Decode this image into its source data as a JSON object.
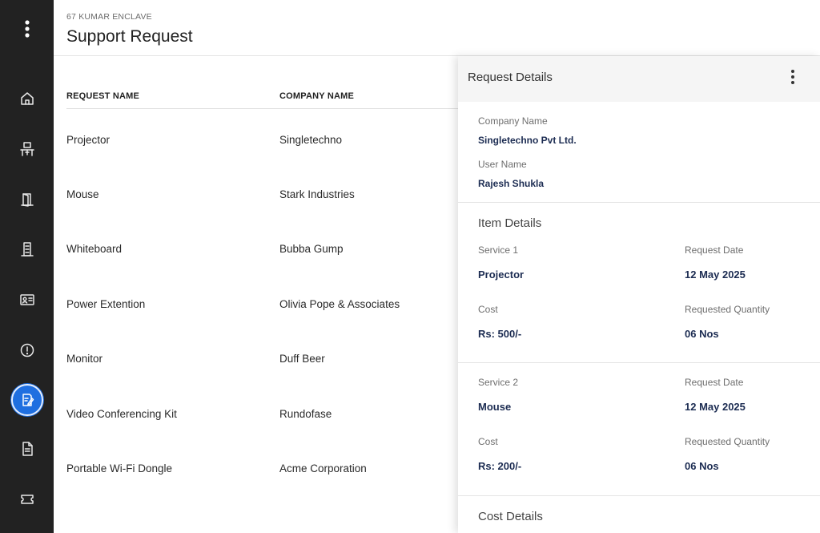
{
  "sidebar": {
    "items": [
      {
        "name": "home",
        "icon": "home-icon"
      },
      {
        "name": "workstation",
        "icon": "desk-icon"
      },
      {
        "name": "rooms",
        "icon": "door-icon"
      },
      {
        "name": "building",
        "icon": "building-icon"
      },
      {
        "name": "id-card",
        "icon": "id-card-icon"
      },
      {
        "name": "alerts",
        "icon": "alert-icon"
      },
      {
        "name": "support-request",
        "icon": "edit-note-icon",
        "active": true
      },
      {
        "name": "documents",
        "icon": "document-icon"
      },
      {
        "name": "tickets",
        "icon": "ticket-icon"
      }
    ]
  },
  "header": {
    "breadcrumb": "67 KUMAR ENCLAVE",
    "title": "Support Request"
  },
  "table": {
    "columns": [
      "REQUEST NAME",
      "COMPANY NAME"
    ],
    "rows": [
      {
        "request": "Projector",
        "company": "Singletechno"
      },
      {
        "request": "Mouse",
        "company": "Stark Industries"
      },
      {
        "request": "Whiteboard",
        "company": "Bubba Gump"
      },
      {
        "request": "Power Extention",
        "company": "Olivia Pope & Associates"
      },
      {
        "request": "Monitor",
        "company": "Duff Beer"
      },
      {
        "request": "Video Conferencing Kit",
        "company": "Rundofase"
      },
      {
        "request": "Portable Wi-Fi Dongle",
        "company": "Acme Corporation"
      }
    ]
  },
  "details": {
    "title": "Request Details",
    "company_label": "Company Name",
    "company_value": "Singletechno Pvt Ltd.",
    "user_label": "User Name",
    "user_value": "Rajesh Shukla",
    "item_section": "Item Details",
    "services": [
      {
        "service_label": "Service 1",
        "service_value": "Projector",
        "date_label": "Request Date",
        "date_value": "12 May 2025",
        "cost_label": "Cost",
        "cost_value": "Rs: 500/-",
        "qty_label": "Requested Quantity",
        "qty_value": "06 Nos"
      },
      {
        "service_label": "Service 2",
        "service_value": "Mouse",
        "date_label": "Request Date",
        "date_value": "12 May 2025",
        "cost_label": "Cost",
        "cost_value": "Rs: 200/-",
        "qty_label": "Requested Quantity",
        "qty_value": "06 Nos"
      }
    ],
    "cost_section": "Cost Details"
  },
  "colors": {
    "sidebar_bg": "#222222",
    "accent": "#1f6fe0",
    "value_text": "#1c2c52"
  }
}
